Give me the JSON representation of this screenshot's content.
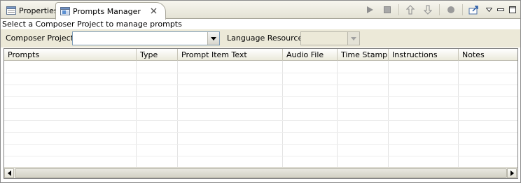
{
  "tabs": [
    {
      "label": "Properties",
      "icon": "properties-icon",
      "active": false
    },
    {
      "label": "Prompts Manager",
      "icon": "prompts-manager-icon",
      "active": true
    }
  ],
  "toolbar": {
    "buttons": [
      "play-icon",
      "stop-icon",
      "move-up-icon",
      "move-down-icon",
      "record-icon",
      "export-icon",
      "view-menu-icon",
      "minimize-icon",
      "maximize-icon"
    ]
  },
  "status_text": "Select a Composer Project to manage prompts",
  "form": {
    "composer_project_label": "Composer Project:",
    "composer_project_value": "",
    "language_resource_label": "Language Resource:",
    "language_resource_value": ""
  },
  "table": {
    "columns": [
      "Prompts",
      "Type",
      "Prompt Item Text",
      "Audio File",
      "Time Stamp",
      "Instructions",
      "Notes"
    ],
    "rows": []
  },
  "colors": {
    "panel_bg": "#ece9d8",
    "border": "#7f9db9"
  }
}
